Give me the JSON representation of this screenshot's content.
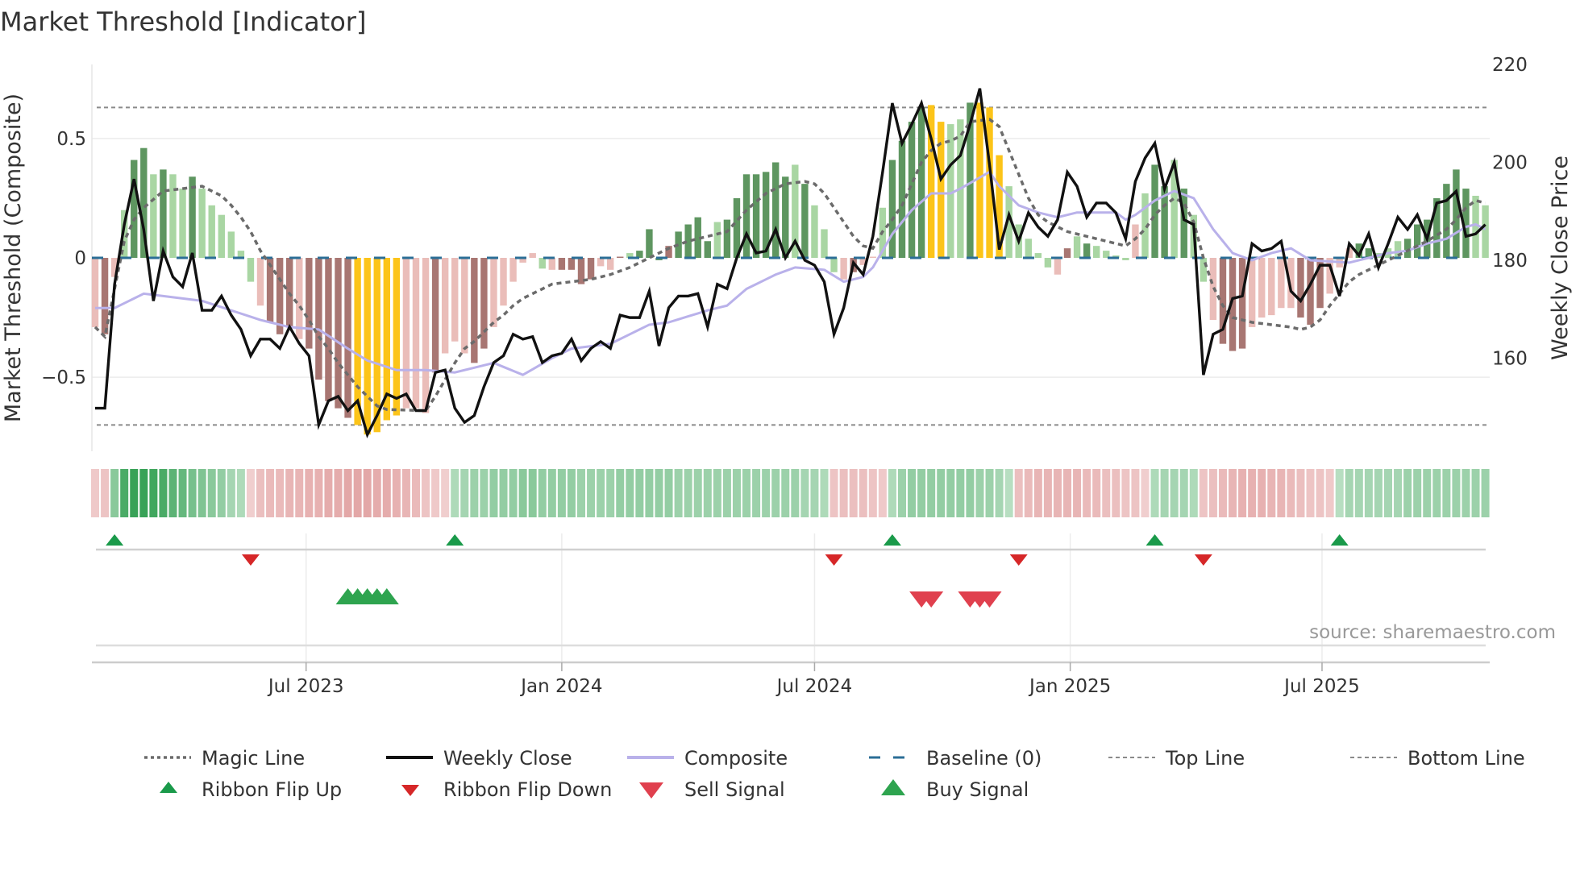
{
  "chart_data": {
    "type": "bar+line",
    "title": "Market Threshold [Indicator]",
    "ylabel_left": "Market Threshold (Composite)",
    "ylabel_right": "Weekly Close Price",
    "ylim_left": [
      -0.81,
      0.81
    ],
    "ylim_right": [
      141,
      220
    ],
    "y_ticks_left": [
      {
        "value": 0.5,
        "label": "0.5"
      },
      {
        "value": 0,
        "label": "0"
      },
      {
        "value": -0.5,
        "label": "−0.5"
      }
    ],
    "y_ticks_right": [
      {
        "value": 220,
        "label": "220"
      },
      {
        "value": 200,
        "label": "200"
      },
      {
        "value": 180,
        "label": "180"
      },
      {
        "value": 160,
        "label": "160"
      }
    ],
    "x_unit": "week index (1 = first weekly bar)",
    "x_range": [
      1,
      144
    ],
    "x_ticks": [
      {
        "week": 22.7,
        "label": "Jul 2023"
      },
      {
        "week": 49.0,
        "label": "Jan 2024"
      },
      {
        "week": 75.0,
        "label": "Jul 2024"
      },
      {
        "week": 101.3,
        "label": "Jan 2025"
      },
      {
        "week": 127.2,
        "label": "Jul 2025"
      }
    ],
    "top_line": 0.63,
    "bottom_line": -0.7,
    "baseline": 0,
    "histogram": {
      "values": [
        -0.29,
        -0.32,
        -0.08,
        0.2,
        0.41,
        0.46,
        0.35,
        0.37,
        0.35,
        0.29,
        0.34,
        0.29,
        0.22,
        0.18,
        0.11,
        0.03,
        -0.1,
        -0.2,
        -0.27,
        -0.32,
        -0.29,
        -0.34,
        -0.38,
        -0.51,
        -0.6,
        -0.63,
        -0.67,
        -0.7,
        -0.74,
        -0.73,
        -0.68,
        -0.66,
        -0.63,
        -0.63,
        -0.65,
        -0.48,
        -0.4,
        -0.35,
        -0.4,
        -0.44,
        -0.38,
        -0.29,
        -0.2,
        -0.1,
        -0.02,
        0.02,
        -0.045,
        -0.05,
        -0.05,
        -0.05,
        -0.11,
        -0.09,
        -0.035,
        -0.05,
        0.005,
        0.02,
        0.03,
        0.12,
        -0.01,
        0.05,
        0.11,
        0.14,
        0.17,
        0.07,
        0.15,
        0.16,
        0.25,
        0.35,
        0.35,
        0.36,
        0.4,
        0.34,
        0.39,
        0.31,
        0.22,
        0.12,
        -0.06,
        -0.09,
        -0.06,
        -0.03,
        0.005,
        0.21,
        0.41,
        0.49,
        0.57,
        0.63,
        0.64,
        0.57,
        0.56,
        0.58,
        0.65,
        0.65,
        0.63,
        0.43,
        0.3,
        0.14,
        0.08,
        0.02,
        -0.04,
        -0.07,
        0.04,
        0.09,
        0.06,
        0.05,
        0.03,
        0.01,
        -0.01,
        0.14,
        0.27,
        0.39,
        0.3,
        0.41,
        0.29,
        0.18,
        -0.1,
        -0.26,
        -0.36,
        -0.39,
        -0.38,
        -0.29,
        -0.25,
        -0.24,
        -0.21,
        -0.21,
        -0.25,
        -0.28,
        -0.21,
        -0.15,
        -0.04,
        0.04,
        0.06,
        0.04,
        0.02,
        0.04,
        0.07,
        0.08,
        0.14,
        0.16,
        0.25,
        0.31,
        0.37,
        0.29,
        0.26,
        0.22
      ],
      "states": "pBpgGGgGggGggggggpBBBpBBBBBYYYYYpppBpppBBpppppgpBBBBppBgGGGBGGGGgGGGGGGGgGgggpBppgGGGGYYggGYYYgggggpBgGggggpgGGgGggpBBBpppppBBBpppGGgggGGGGGGGggg",
      "state_colors": {
        "G": "#5e9660",
        "g": "#a9d6a3",
        "B": "#a87672",
        "p": "#eabdb9",
        "Y": "#fcc419"
      }
    },
    "weekly_close": [
      149.8,
      149.8,
      175.1,
      187.3,
      196.6,
      186.3,
      171.7,
      181.9,
      176.6,
      174.6,
      181.5,
      169.8,
      169.8,
      172.7,
      168.8,
      165.9,
      160.5,
      163.9,
      163.9,
      162.0,
      166.4,
      163.0,
      160.5,
      146.4,
      151.3,
      152.2,
      149.3,
      151.3,
      144.4,
      148.3,
      152.7,
      151.8,
      152.7,
      149.3,
      149.3,
      157.1,
      157.6,
      149.8,
      146.9,
      148.3,
      154.2,
      159.1,
      160.5,
      164.9,
      163.9,
      164.4,
      159.1,
      160.5,
      161.0,
      163.9,
      159.5,
      162.0,
      163.4,
      162.0,
      168.8,
      168.3,
      168.3,
      173.7,
      162.5,
      170.3,
      172.7,
      172.7,
      173.2,
      166.4,
      175.1,
      174.2,
      180.5,
      185.4,
      181.5,
      181.9,
      186.3,
      180.5,
      183.9,
      180.0,
      179.0,
      175.6,
      164.9,
      170.3,
      179.5,
      177.1,
      184.9,
      198.0,
      212.1,
      203.9,
      207.8,
      212.1,
      204.8,
      196.6,
      199.5,
      201.4,
      207.8,
      215.1,
      199.5,
      182.2,
      189.3,
      183.9,
      189.7,
      186.8,
      184.9,
      188.3,
      198.0,
      195.1,
      188.8,
      191.7,
      191.7,
      189.7,
      184.4,
      196.1,
      200.9,
      203.9,
      194.6,
      200.0,
      188.3,
      187.3,
      156.6,
      164.9,
      165.9,
      172.2,
      172.7,
      183.4,
      181.9,
      182.4,
      183.9,
      173.7,
      171.7,
      175.1,
      179.0,
      179.0,
      172.7,
      183.4,
      181.0,
      185.4,
      178.5,
      183.4,
      188.8,
      186.3,
      189.3,
      184.4,
      191.7,
      192.2,
      194.1,
      184.9,
      185.4,
      187.3
    ],
    "composite": [
      [
        1,
        -0.21
      ],
      [
        3,
        -0.21
      ],
      [
        6,
        -0.15
      ],
      [
        10,
        -0.17
      ],
      [
        12,
        -0.18
      ],
      [
        15,
        -0.22
      ],
      [
        18,
        -0.26
      ],
      [
        21,
        -0.29
      ],
      [
        24,
        -0.3
      ],
      [
        27,
        -0.38
      ],
      [
        29,
        -0.43
      ],
      [
        32,
        -0.47
      ],
      [
        35,
        -0.47
      ],
      [
        38,
        -0.48
      ],
      [
        40,
        -0.46
      ],
      [
        42,
        -0.44
      ],
      [
        45,
        -0.49
      ],
      [
        48,
        -0.42
      ],
      [
        50,
        -0.38
      ],
      [
        54,
        -0.36
      ],
      [
        58,
        -0.28
      ],
      [
        60,
        -0.27
      ],
      [
        64,
        -0.22
      ],
      [
        66,
        -0.2
      ],
      [
        68,
        -0.13
      ],
      [
        71,
        -0.07
      ],
      [
        73,
        -0.04
      ],
      [
        76,
        -0.05
      ],
      [
        78,
        -0.1
      ],
      [
        80,
        -0.08
      ],
      [
        81,
        -0.04
      ],
      [
        83,
        0.1
      ],
      [
        85,
        0.2
      ],
      [
        87,
        0.27
      ],
      [
        89,
        0.27
      ],
      [
        90,
        0.29
      ],
      [
        93,
        0.36
      ],
      [
        94,
        0.3
      ],
      [
        96,
        0.22
      ],
      [
        98,
        0.19
      ],
      [
        100,
        0.17
      ],
      [
        102,
        0.19
      ],
      [
        106,
        0.19
      ],
      [
        107,
        0.16
      ],
      [
        108,
        0.18
      ],
      [
        110,
        0.24
      ],
      [
        112,
        0.28
      ],
      [
        114,
        0.25
      ],
      [
        116,
        0.12
      ],
      [
        118,
        0.02
      ],
      [
        120,
        -0.01
      ],
      [
        122,
        0.02
      ],
      [
        124,
        0.04
      ],
      [
        126,
        -0.01
      ],
      [
        130,
        -0.02
      ],
      [
        132,
        0.0
      ],
      [
        134,
        0.02
      ],
      [
        136,
        0.03
      ],
      [
        138,
        0.06
      ],
      [
        140,
        0.08
      ],
      [
        142,
        0.13
      ],
      [
        143,
        0.14
      ],
      [
        144,
        0.12
      ]
    ],
    "magic_line": [
      [
        1,
        -0.29
      ],
      [
        2,
        -0.33
      ],
      [
        3,
        -0.13
      ],
      [
        4,
        0.07
      ],
      [
        5,
        0.16
      ],
      [
        6,
        0.21
      ],
      [
        8,
        0.28
      ],
      [
        10,
        0.29
      ],
      [
        12,
        0.3
      ],
      [
        14,
        0.26
      ],
      [
        15,
        0.22
      ],
      [
        16,
        0.17
      ],
      [
        17,
        0.11
      ],
      [
        18,
        0.03
      ],
      [
        19,
        -0.03
      ],
      [
        20,
        -0.09
      ],
      [
        21,
        -0.15
      ],
      [
        22,
        -0.2
      ],
      [
        23,
        -0.26
      ],
      [
        24,
        -0.33
      ],
      [
        25,
        -0.38
      ],
      [
        26,
        -0.44
      ],
      [
        27,
        -0.49
      ],
      [
        28,
        -0.54
      ],
      [
        29,
        -0.58
      ],
      [
        30,
        -0.62
      ],
      [
        31,
        -0.635
      ],
      [
        35,
        -0.64
      ],
      [
        36,
        -0.58
      ],
      [
        37,
        -0.51
      ],
      [
        38,
        -0.44
      ],
      [
        39,
        -0.38
      ],
      [
        40,
        -0.35
      ],
      [
        41,
        -0.31
      ],
      [
        42,
        -0.27
      ],
      [
        43,
        -0.24
      ],
      [
        44,
        -0.2
      ],
      [
        45,
        -0.17
      ],
      [
        46,
        -0.15
      ],
      [
        47,
        -0.13
      ],
      [
        48,
        -0.11
      ],
      [
        50,
        -0.1
      ],
      [
        52,
        -0.09
      ],
      [
        54,
        -0.07
      ],
      [
        56,
        -0.04
      ],
      [
        58,
        0.0
      ],
      [
        60,
        0.04
      ],
      [
        62,
        0.07
      ],
      [
        64,
        0.09
      ],
      [
        66,
        0.11
      ],
      [
        68,
        0.2
      ],
      [
        70,
        0.27
      ],
      [
        72,
        0.31
      ],
      [
        74,
        0.32
      ],
      [
        75,
        0.31
      ],
      [
        76,
        0.27
      ],
      [
        77,
        0.21
      ],
      [
        78,
        0.15
      ],
      [
        79,
        0.09
      ],
      [
        80,
        0.05
      ],
      [
        81,
        0.04
      ],
      [
        82,
        0.11
      ],
      [
        83,
        0.16
      ],
      [
        84,
        0.22
      ],
      [
        85,
        0.31
      ],
      [
        86,
        0.4
      ],
      [
        87,
        0.45
      ],
      [
        88,
        0.48
      ],
      [
        89,
        0.49
      ],
      [
        90,
        0.51
      ],
      [
        91,
        0.57
      ],
      [
        93,
        0.58
      ],
      [
        94,
        0.55
      ],
      [
        95,
        0.45
      ],
      [
        96,
        0.35
      ],
      [
        97,
        0.25
      ],
      [
        98,
        0.18
      ],
      [
        99,
        0.15
      ],
      [
        100,
        0.13
      ],
      [
        101,
        0.11
      ],
      [
        102,
        0.1
      ],
      [
        104,
        0.08
      ],
      [
        106,
        0.06
      ],
      [
        107,
        0.05
      ],
      [
        108,
        0.08
      ],
      [
        109,
        0.12
      ],
      [
        110,
        0.18
      ],
      [
        111,
        0.22
      ],
      [
        112,
        0.25
      ],
      [
        113,
        0.23
      ],
      [
        114,
        0.15
      ],
      [
        115,
        0.0
      ],
      [
        116,
        -0.12
      ],
      [
        117,
        -0.2
      ],
      [
        118,
        -0.25
      ],
      [
        120,
        -0.27
      ],
      [
        122,
        -0.28
      ],
      [
        124,
        -0.29
      ],
      [
        125,
        -0.3
      ],
      [
        126,
        -0.29
      ],
      [
        127,
        -0.26
      ],
      [
        128,
        -0.2
      ],
      [
        129,
        -0.15
      ],
      [
        130,
        -0.1
      ],
      [
        131,
        -0.07
      ],
      [
        132,
        -0.05
      ],
      [
        134,
        -0.01
      ],
      [
        136,
        0.03
      ],
      [
        138,
        0.07
      ],
      [
        140,
        0.12
      ],
      [
        141,
        0.16
      ],
      [
        142,
        0.21
      ],
      [
        143,
        0.24
      ],
      [
        144,
        0.23
      ]
    ],
    "ribbon": [
      -0.25,
      -0.3,
      0.5,
      0.85,
      0.95,
      0.95,
      0.9,
      0.85,
      0.75,
      0.7,
      0.6,
      0.55,
      0.5,
      0.45,
      0.35,
      0.3,
      -0.2,
      -0.35,
      -0.4,
      -0.4,
      -0.45,
      -0.45,
      -0.5,
      -0.5,
      -0.55,
      -0.55,
      -0.6,
      -0.6,
      -0.6,
      -0.55,
      -0.55,
      -0.5,
      -0.45,
      -0.4,
      -0.3,
      -0.25,
      -0.2,
      0.3,
      0.35,
      0.4,
      0.4,
      0.45,
      0.45,
      0.45,
      0.5,
      0.5,
      0.45,
      0.45,
      0.45,
      0.45,
      0.4,
      0.4,
      0.4,
      0.4,
      0.45,
      0.45,
      0.45,
      0.45,
      0.45,
      0.45,
      0.4,
      0.4,
      0.4,
      0.4,
      0.4,
      0.4,
      0.4,
      0.4,
      0.4,
      0.4,
      0.4,
      0.4,
      0.4,
      0.35,
      0.35,
      0.3,
      -0.3,
      -0.35,
      -0.35,
      -0.35,
      -0.3,
      -0.25,
      0.3,
      0.4,
      0.45,
      0.45,
      0.45,
      0.45,
      0.45,
      0.45,
      0.45,
      0.4,
      0.4,
      0.35,
      0.25,
      -0.35,
      -0.4,
      -0.45,
      -0.45,
      -0.45,
      -0.45,
      -0.45,
      -0.4,
      -0.4,
      -0.35,
      -0.35,
      -0.3,
      -0.3,
      -0.2,
      0.3,
      0.35,
      0.35,
      0.35,
      0.3,
      -0.3,
      -0.35,
      -0.4,
      -0.45,
      -0.5,
      -0.5,
      -0.5,
      -0.45,
      -0.45,
      -0.4,
      -0.35,
      -0.3,
      -0.3,
      -0.25,
      0.25,
      0.35,
      0.35,
      0.35,
      0.35,
      0.35,
      0.35,
      0.4,
      0.4,
      0.4,
      0.4,
      0.4,
      0.4,
      0.4,
      0.4,
      0.4
    ],
    "ribbon_flip_up": [
      3,
      38,
      83,
      110,
      129
    ],
    "ribbon_flip_down": [
      17,
      77,
      96,
      115
    ],
    "buy_signals": [
      27,
      28,
      29,
      30,
      31
    ],
    "sell_signals": [
      86,
      87,
      91,
      92,
      93
    ],
    "colors": {
      "weekly_close": "#111111",
      "composite": "#b9b1ea",
      "magic_line": "#6b6b6b",
      "baseline": "#2b6e96",
      "threshold_lines": "#8a8a8a",
      "flip_up": "#1a9a4a",
      "flip_down": "#d62728",
      "buy": "#2ea44f",
      "sell": "#e0404e"
    },
    "legend": [
      {
        "key": "magic",
        "label": "Magic Line"
      },
      {
        "key": "close",
        "label": "Weekly Close"
      },
      {
        "key": "composite",
        "label": "Composite"
      },
      {
        "key": "baseline",
        "label": "Baseline (0)"
      },
      {
        "key": "top",
        "label": "Top Line"
      },
      {
        "key": "bottom",
        "label": "Bottom Line"
      },
      {
        "key": "flip_up",
        "label": "Ribbon Flip Up"
      },
      {
        "key": "flip_down",
        "label": "Ribbon Flip Down"
      },
      {
        "key": "sell",
        "label": "Sell Signal"
      },
      {
        "key": "buy",
        "label": "Buy Signal"
      }
    ],
    "legend_placement": "bottom",
    "source": "source: sharemaestro.com"
  }
}
